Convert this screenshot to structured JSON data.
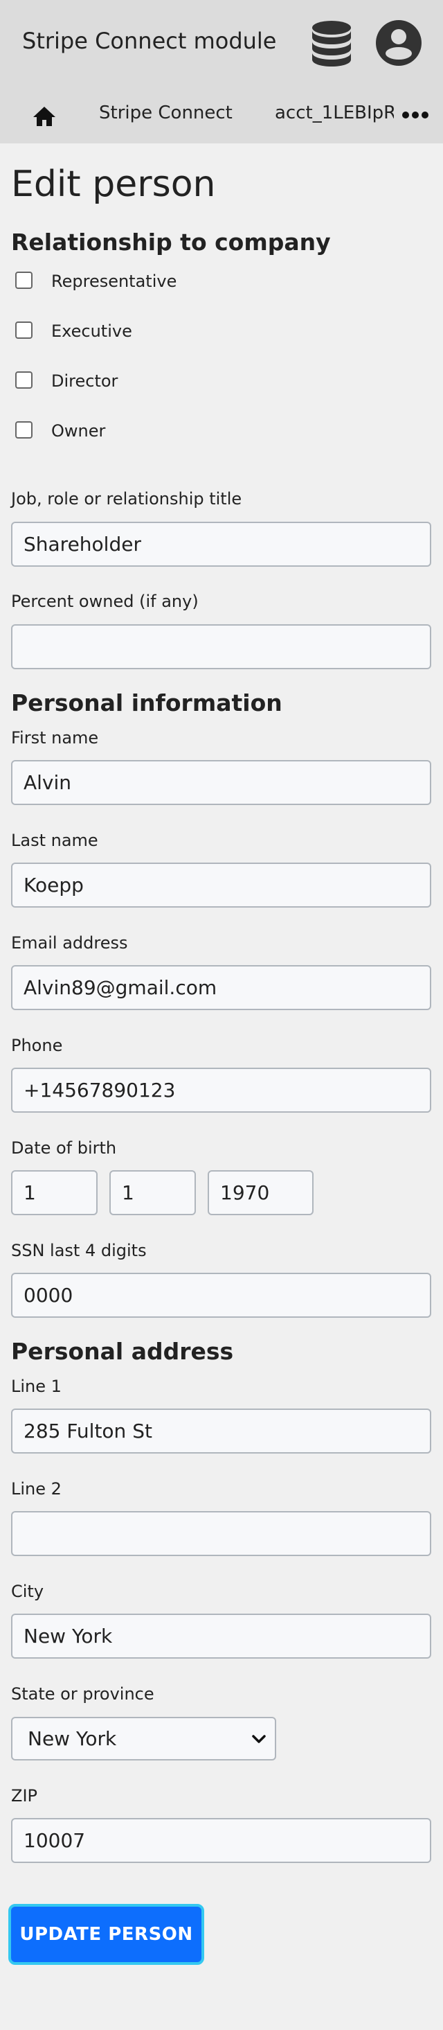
{
  "header": {
    "title": "Stripe Connect module",
    "database_icon": "database-icon",
    "user_icon": "user-circle-icon"
  },
  "breadcrumb": {
    "home_icon": "home-icon",
    "items": [
      "Stripe Connect",
      "acct_1LEBIpR"
    ],
    "more_icon": "more-horizontal-icon"
  },
  "page": {
    "title": "Edit person"
  },
  "relationship": {
    "heading": "Relationship to company",
    "options": [
      {
        "label": "Representative",
        "checked": false
      },
      {
        "label": "Executive",
        "checked": false
      },
      {
        "label": "Director",
        "checked": false
      },
      {
        "label": "Owner",
        "checked": false
      }
    ],
    "title_label": "Job, role or relationship title",
    "title_value": "Shareholder",
    "percent_label": "Percent owned (if any)",
    "percent_value": ""
  },
  "personal": {
    "heading": "Personal information",
    "first_name_label": "First name",
    "first_name": "Alvin",
    "last_name_label": "Last name",
    "last_name": "Koepp",
    "email_label": "Email address",
    "email": "Alvin89@gmail.com",
    "phone_label": "Phone",
    "phone": "+14567890123",
    "dob_label": "Date of birth",
    "dob_day": "1",
    "dob_month": "1",
    "dob_year": "1970",
    "ssn_label": "SSN last 4 digits",
    "ssn": "0000"
  },
  "address": {
    "heading": "Personal address",
    "line1_label": "Line 1",
    "line1": "285 Fulton St",
    "line2_label": "Line 2",
    "line2": "",
    "city_label": "City",
    "city": "New York",
    "state_label": "State or province",
    "state": "New York",
    "zip_label": "ZIP",
    "zip": "10007"
  },
  "actions": {
    "update_label": "UPDATE PERSON"
  },
  "colors": {
    "header_bg": "#dcdcdc",
    "page_bg": "#f0f0f0",
    "primary_button": "#0d6efd",
    "button_focus_ring": "#34c8f0"
  }
}
